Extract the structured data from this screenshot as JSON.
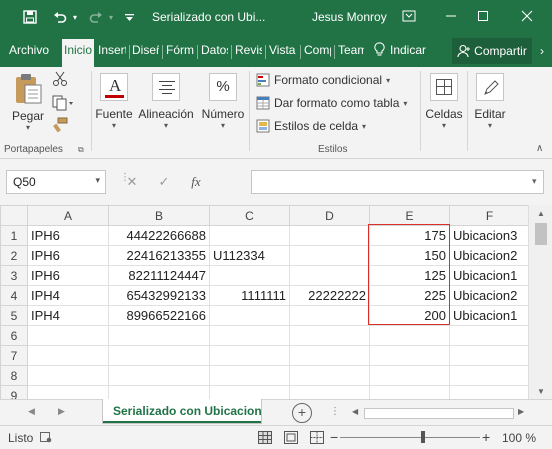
{
  "titlebar": {
    "title": "Serializado con Ubi...",
    "user": "Jesus Monroy"
  },
  "tabs": [
    {
      "label": "Archivo"
    },
    {
      "label": "Inicio"
    },
    {
      "label": "Insertar"
    },
    {
      "label": "Diseño"
    },
    {
      "label": "Fórmulas"
    },
    {
      "label": "Datos"
    },
    {
      "label": "Revisar"
    },
    {
      "label": "Vista"
    },
    {
      "label": "Complementos"
    },
    {
      "label": "Team"
    }
  ],
  "tell_me": "Indicar",
  "share": "Compartir",
  "ribbon": {
    "paste": "Pegar",
    "clipboard_group": "Portapapeles",
    "font": "Fuente",
    "alignment": "Alineación",
    "number": "Número",
    "number_icon": "%",
    "conditional_format": "Formato condicional",
    "format_as_table": "Dar formato como tabla",
    "cell_styles": "Estilos de celda",
    "styles_group": "Estilos",
    "cells": "Celdas",
    "edit": "Editar"
  },
  "formula_bar": {
    "name_box": "Q50",
    "fx": "fx",
    "formula": ""
  },
  "columns": [
    "A",
    "B",
    "C",
    "D",
    "E",
    "F"
  ],
  "rows": [
    {
      "num": "1",
      "A": "IPH6",
      "B": "44422266688",
      "C": "",
      "D": "",
      "E": "175",
      "F": "Ubicacion3"
    },
    {
      "num": "2",
      "A": "IPH6",
      "B": "22416213355",
      "C": "U112334",
      "D": "",
      "E": "150",
      "F": "Ubicacion2"
    },
    {
      "num": "3",
      "A": "IPH6",
      "B": "82211124447",
      "C": "",
      "D": "",
      "E": "125",
      "F": "Ubicacion1"
    },
    {
      "num": "4",
      "A": "IPH4",
      "B": "65432992133",
      "C": "1111111",
      "D": "22222222",
      "E": "225",
      "F": "Ubicacion2"
    },
    {
      "num": "5",
      "A": "IPH4",
      "B": "89966522166",
      "C": "",
      "D": "",
      "E": "200",
      "F": "Ubicacion1"
    },
    {
      "num": "6",
      "A": "",
      "B": "",
      "C": "",
      "D": "",
      "E": "",
      "F": ""
    },
    {
      "num": "7",
      "A": "",
      "B": "",
      "C": "",
      "D": "",
      "E": "",
      "F": ""
    },
    {
      "num": "8",
      "A": "",
      "B": "",
      "C": "",
      "D": "",
      "E": "",
      "F": ""
    },
    {
      "num": "9",
      "A": "",
      "B": "",
      "C": "",
      "D": "",
      "E": "",
      "F": ""
    }
  ],
  "sheet_tab": "Serializado con Ubicacion",
  "status": {
    "ready": "Listo",
    "zoom": "100 %"
  },
  "colors": {
    "brand": "#217346",
    "selection_border": "#d9302b"
  }
}
